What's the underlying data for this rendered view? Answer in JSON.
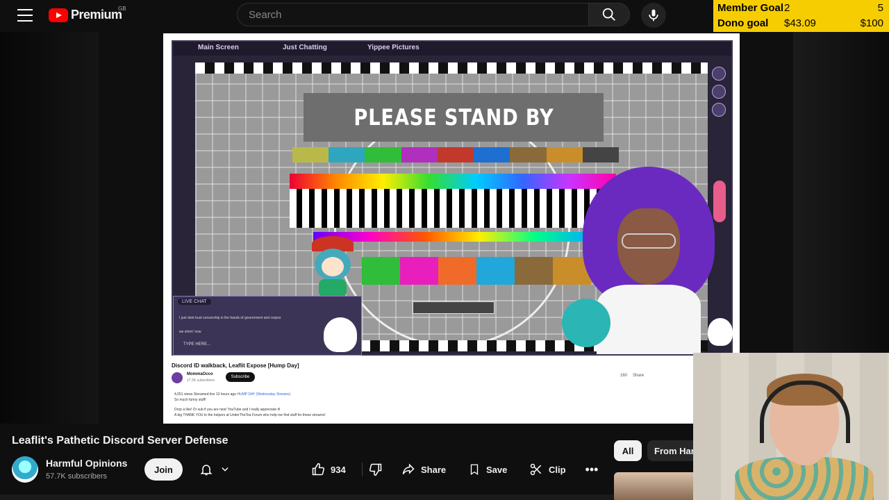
{
  "header": {
    "logo_text": "Premium",
    "region": "GB",
    "search_placeholder": "Search"
  },
  "goals": [
    {
      "label": "Member Goal",
      "current": "2",
      "target": "5"
    },
    {
      "label": "Dono goal",
      "current": "$43.09",
      "target": "$100"
    }
  ],
  "stream": {
    "tabs": [
      "Main Screen",
      "Just Chatting",
      "Yippee Pictures"
    ],
    "standby_text": "PLEASE STAND BY",
    "live_chat_label": "LIVE CHAT",
    "chat_lines": [
      "I just dont trust censorship in the hands of government and corpos",
      "we stirrin' now"
    ],
    "type_here": "TYPE HERE..."
  },
  "embedded_video": {
    "title": "Discord ID walkback, Leaflit Expose [Hump Day]",
    "channel": "MommaOcco",
    "subscribers": "17.2K subscribers",
    "subscribe_label": "Subscribe",
    "likes": "160",
    "share_label": "Share",
    "meta": "4,051 views  Streamed live 13 hours ago",
    "playlist_link": "HUMP DAY (Wednesday Streams)",
    "desc_line1": "So much funny stuff!",
    "desc_line2": "Drop a like! Or sub if you are new! YouTube and I really appreciate it!",
    "desc_line3": "A big THANK YOU to the helpers at UnderTheTea Forum who help me find stuff for these streams!"
  },
  "video": {
    "title": "Leaflit's Pathetic Discord Server Defense",
    "channel_name": "Harmful Opinions",
    "subscribers": "57.7K subscribers",
    "join_label": "Join",
    "like_count": "934",
    "share_label": "Share",
    "save_label": "Save",
    "clip_label": "Clip",
    "more_label": "•••"
  },
  "chips": {
    "all": "All",
    "from": "From Har"
  },
  "colors": {
    "goal_bg": "#f6cd00",
    "yt_red": "#ff0000",
    "bg": "#0f0f0f"
  }
}
